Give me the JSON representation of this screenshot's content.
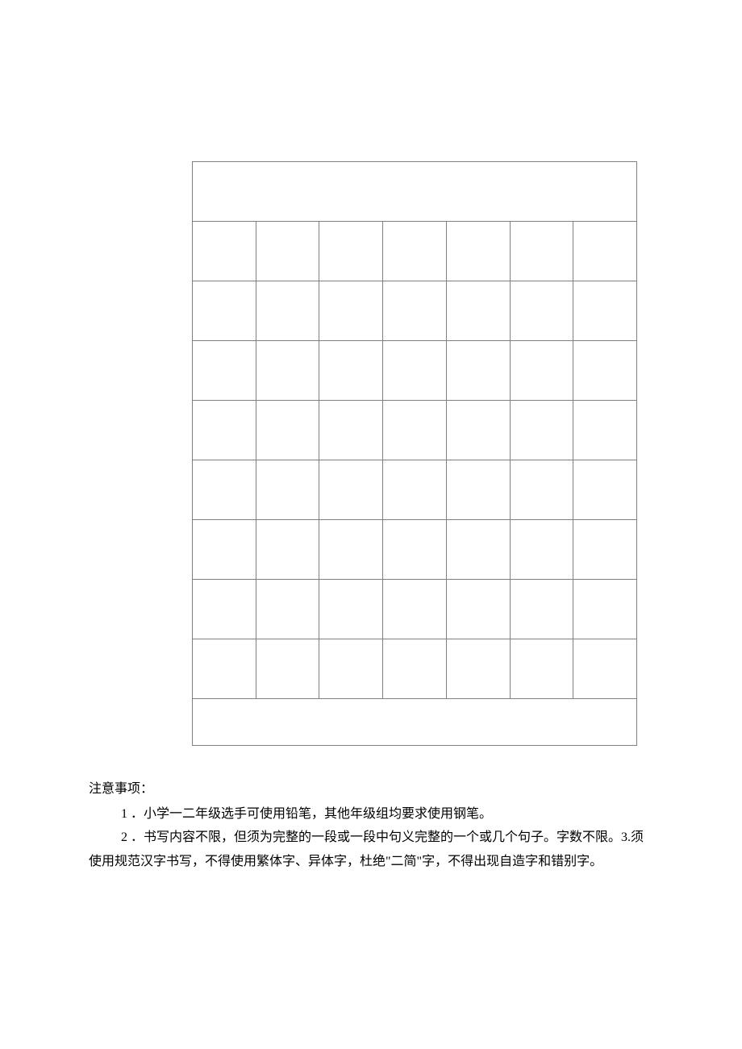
{
  "notes": {
    "title": "注意事项：",
    "item1_prefix": "1 ．",
    "item1_text": "小学一二年级选手可使用铅笔，其他年级组均要求使用钢笔。",
    "item2_prefix": "2 ．",
    "item2_text": "书写内容不限，但须为完整的一段或一段中句义完整的一个或几个句子。字数不限。3.须",
    "item2_continuation": "使用规范汉字书写，不得使用繁体字、异体字，杜绝\"二简\"字，不得出现自造字和错别字。"
  }
}
